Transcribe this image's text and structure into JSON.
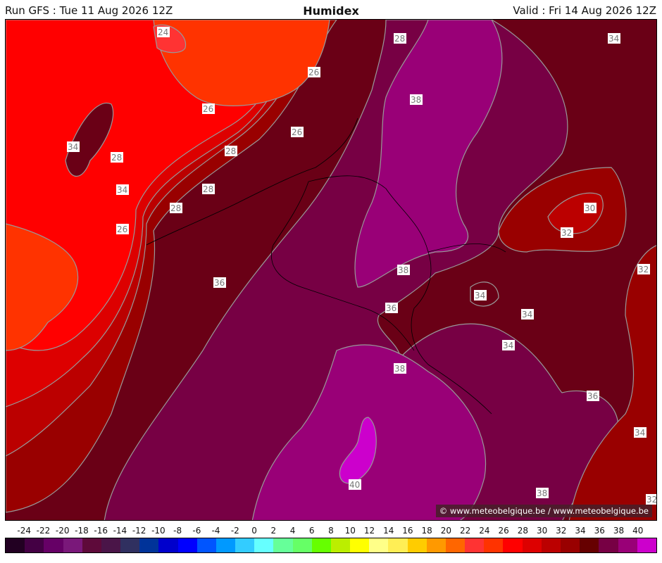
{
  "header": {
    "run": "Run GFS : Tue 11 Aug 2026 12Z",
    "title": "Humidex",
    "valid": "Valid : Fri 14 Aug 2026 12Z"
  },
  "credit": "© www.meteobelgique.be / www.meteobelgique.be",
  "map": {
    "region": "Belgium and surroundings",
    "contour_labels": [
      "24",
      "26",
      "26",
      "26",
      "26",
      "28",
      "28",
      "28",
      "28",
      "28",
      "30",
      "32",
      "32",
      "32",
      "34",
      "34",
      "34",
      "34",
      "34",
      "34",
      "34",
      "36",
      "36",
      "36",
      "38",
      "38",
      "38",
      "38",
      "40"
    ]
  },
  "legend": {
    "ticks": [
      "-24",
      "-22",
      "-20",
      "-18",
      "-16",
      "-14",
      "-12",
      "-10",
      "-8",
      "-6",
      "-4",
      "-2",
      "0",
      "2",
      "4",
      "6",
      "8",
      "10",
      "12",
      "14",
      "16",
      "18",
      "20",
      "22",
      "24",
      "26",
      "28",
      "30",
      "32",
      "34",
      "36",
      "38",
      "40"
    ],
    "colors": [
      "#220022",
      "#440044",
      "#660066",
      "#7a187a",
      "#5e0a3a",
      "#4a1548",
      "#303060",
      "#003399",
      "#0000cc",
      "#0000ff",
      "#0055ff",
      "#0099ff",
      "#33ccff",
      "#66ffff",
      "#66ff99",
      "#66ff66",
      "#66ff00",
      "#bbee00",
      "#ffff00",
      "#ffff88",
      "#ffee55",
      "#ffcc00",
      "#ff9900",
      "#ff6600",
      "#ff3333",
      "#ff3300",
      "#ff0000",
      "#dd0000",
      "#bb0000",
      "#990000",
      "#660000",
      "#770044",
      "#990077",
      "#cc00cc"
    ]
  }
}
